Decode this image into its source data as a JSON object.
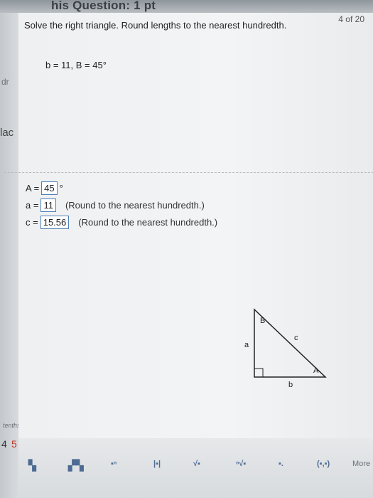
{
  "header": {
    "title": "his Question: 1 pt"
  },
  "counter": "4 of 20",
  "sidebar": {
    "labels": [
      "dr",
      "lac",
      "tenths",
      "4",
      "5"
    ]
  },
  "question": {
    "prompt": "Solve the right triangle. Round lengths to the nearest hundredth.",
    "given": "b = 11, B = 45°"
  },
  "answers": {
    "A": {
      "label": "A =",
      "value": "45",
      "unit": "°"
    },
    "a": {
      "label": "a =",
      "value": "11",
      "hint": "(Round to the nearest hundredth.)"
    },
    "c": {
      "label": "c =",
      "value": "15.56",
      "hint": "(Round to the nearest hundredth.)"
    }
  },
  "diagram": {
    "labels": {
      "A": "A",
      "B": "B",
      "a": "a",
      "b": "b",
      "c": "c"
    }
  },
  "toolbar": {
    "buttons": [
      "fraction",
      "mixed-number",
      "exponent",
      "absolute-value",
      "square-root",
      "nth-root",
      "decimal",
      "interval",
      "More"
    ]
  },
  "colors": {
    "input_border": "#4f7fb8",
    "tool_icon": "#4d6b93"
  }
}
